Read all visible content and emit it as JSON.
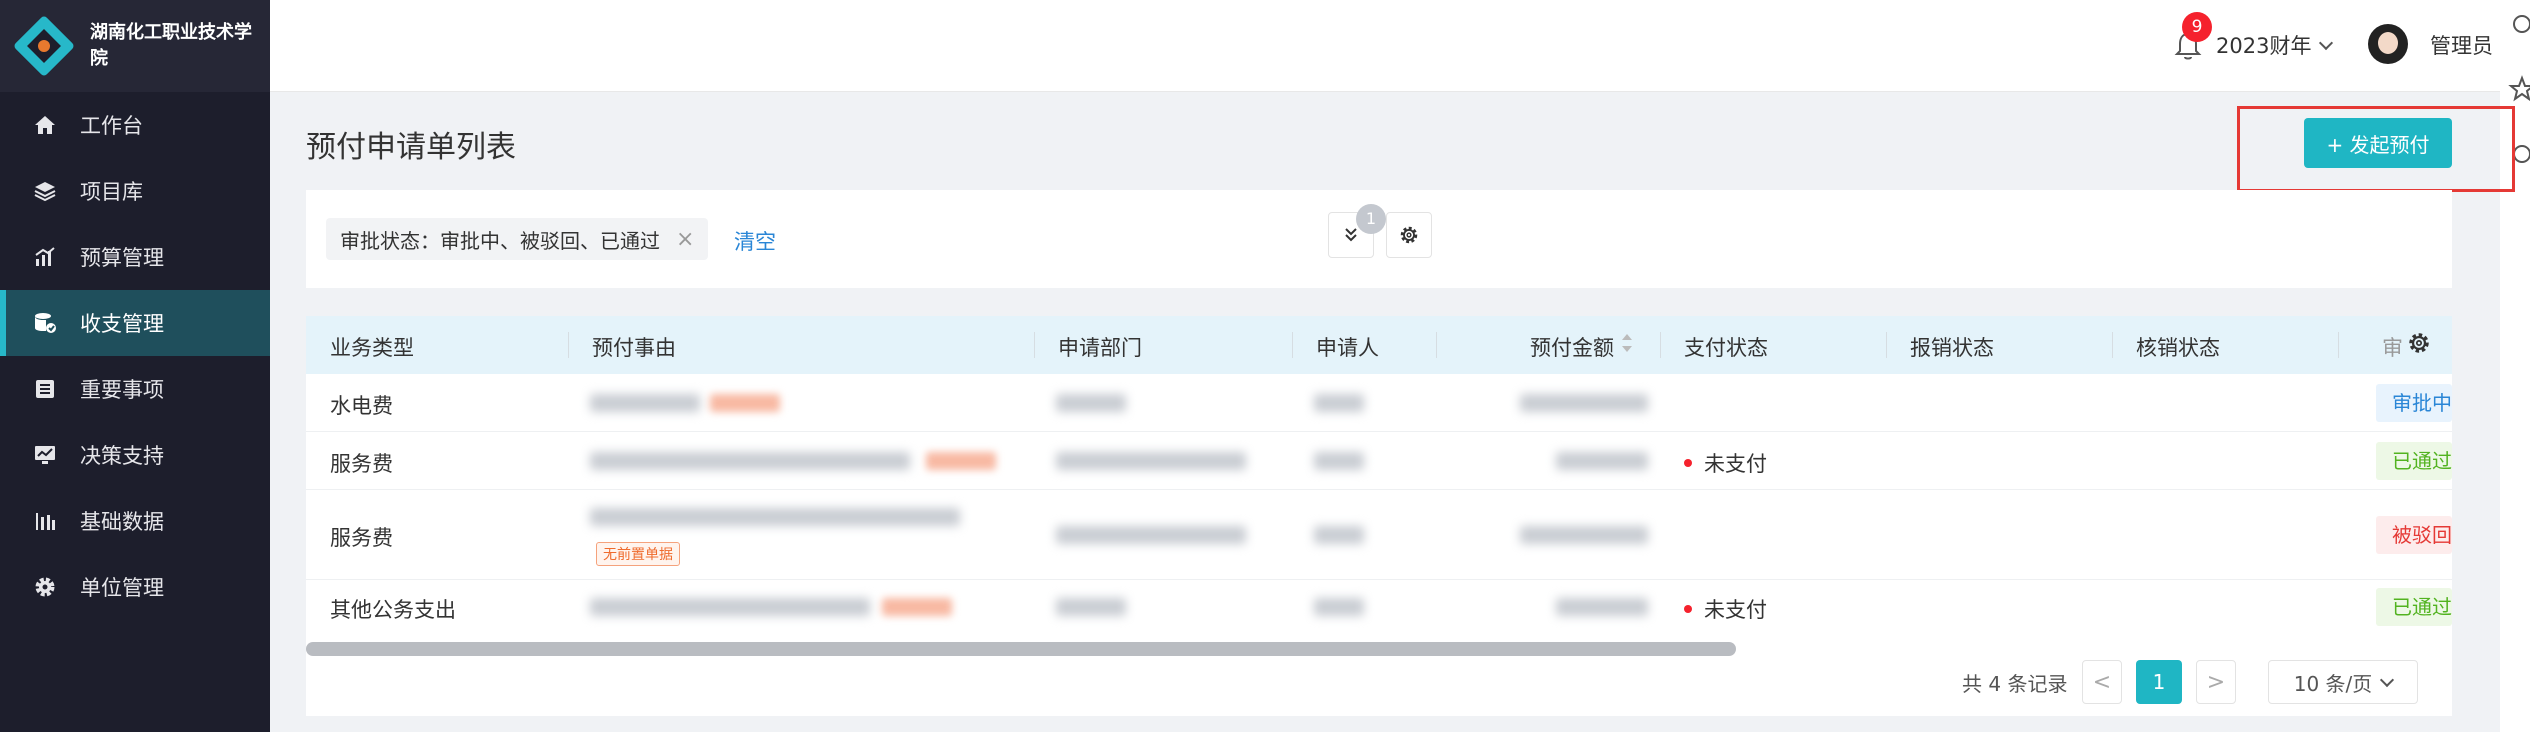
{
  "app": {
    "org_name": "湖南化工职业技术学院"
  },
  "sidebar": {
    "items": [
      {
        "label": "工作台",
        "icon": "home-icon"
      },
      {
        "label": "项目库",
        "icon": "layers-icon"
      },
      {
        "label": "预算管理",
        "icon": "bar-chart-icon"
      },
      {
        "label": "收支管理",
        "icon": "database-icon",
        "active": true
      },
      {
        "label": "重要事项",
        "icon": "list-icon"
      },
      {
        "label": "决策支持",
        "icon": "trend-icon"
      },
      {
        "label": "基础数据",
        "icon": "columns-icon"
      },
      {
        "label": "单位管理",
        "icon": "gear-icon"
      }
    ]
  },
  "topbar": {
    "notification_count": "9",
    "fiscal_year": "2023财年",
    "user_name": "管理员"
  },
  "page": {
    "title": "预付申请单列表",
    "new_button": "+ 发起预付"
  },
  "filter": {
    "chip_label": "审批状态：审批中、被驳回、已通过",
    "clear_label": "清空",
    "active_filter_count": "1"
  },
  "table": {
    "headers": [
      "业务类型",
      "预付事由",
      "申请部门",
      "申请人",
      "预付金额",
      "支付状态",
      "报销状态",
      "核销状态",
      "审"
    ],
    "rows": [
      {
        "type": "水电费",
        "pay_status": "",
        "approval": "审批中"
      },
      {
        "type": "服务费",
        "pay_status": "未支付",
        "approval": "已通过"
      },
      {
        "type": "服务费",
        "pay_status": "",
        "approval": "被驳回",
        "tag": "无前置单据"
      },
      {
        "type": "其他公务支出",
        "pay_status": "未支付",
        "approval": "已通过"
      }
    ]
  },
  "pagination": {
    "total_text": "共 4 条记录",
    "prev": "<",
    "current": "1",
    "next": ">",
    "page_size": "10 条/页"
  },
  "colors": {
    "accent": "#1fb6c4",
    "sidebar_bg": "#1d1e2c",
    "highlight": "#e53935"
  }
}
